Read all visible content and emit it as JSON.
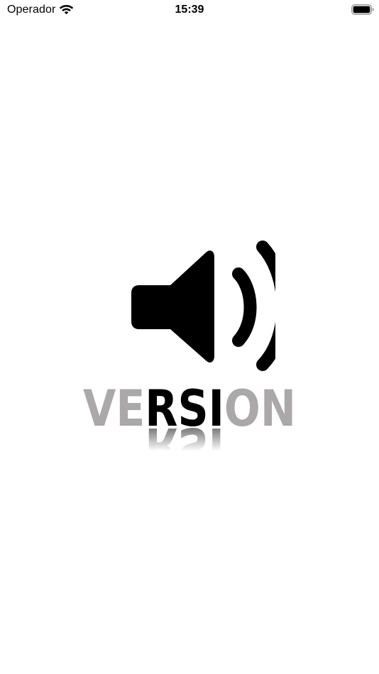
{
  "status_bar": {
    "carrier": "Operador",
    "time": "15:39",
    "icons": {
      "wifi": "wifi-icon",
      "battery": "battery-icon"
    }
  },
  "splash": {
    "logo": {
      "icon": "speaker-volume-icon",
      "wordmark": "VERSION",
      "colors": {
        "gray_letters": "#aaa8a8",
        "dark_letters": "#000000",
        "speaker": "#000000"
      }
    }
  },
  "colors": {
    "background": "#ffffff",
    "text": "#000000"
  }
}
